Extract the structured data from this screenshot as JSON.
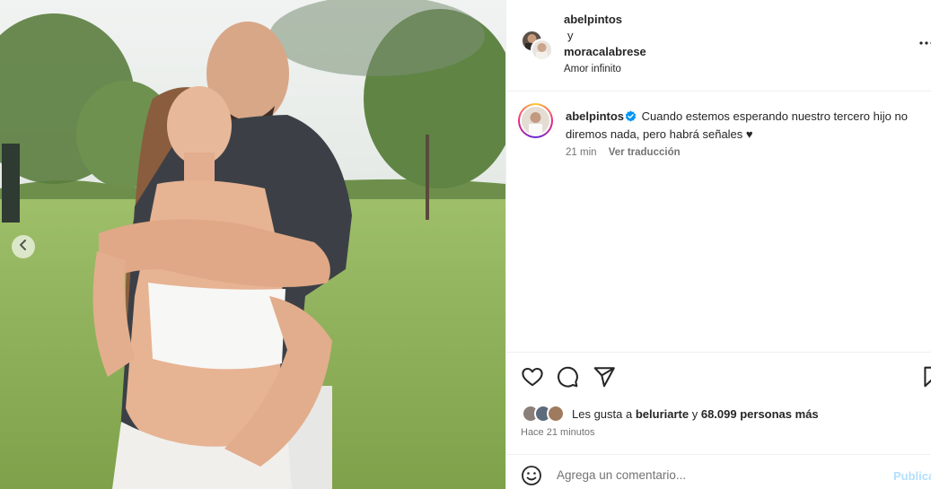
{
  "post": {
    "coauthor_1": "abelpintos",
    "connector": "y",
    "coauthor_2": "moracalabrese",
    "audio": "Amor infinito"
  },
  "caption": {
    "username": "abelpintos",
    "text": "Cuando estemos esperando nuestro tercero hijo no diremos nada, pero habrá señales ♥",
    "age": "21 min",
    "translate_label": "Ver traducción"
  },
  "likes": {
    "prefix": "Les gusta a",
    "first_user": "beluriarte",
    "joiner": "y",
    "others": "68.099 personas más"
  },
  "posted": "Hace 21 minutos",
  "comment": {
    "placeholder": "Agrega un comentario...",
    "publish_label": "Publicar"
  },
  "icons": {
    "like": "heart-icon",
    "comment": "comment-icon",
    "share": "send-icon",
    "save": "bookmark-icon",
    "emoji": "emoji-icon",
    "more": "more-options-icon",
    "carousel_prev": "chevron-left-icon",
    "verified": "verified-badge-icon"
  },
  "colors": {
    "verified": "#0095f6",
    "publish_disabled": "#b2dffc",
    "secondary_text": "#737373"
  }
}
